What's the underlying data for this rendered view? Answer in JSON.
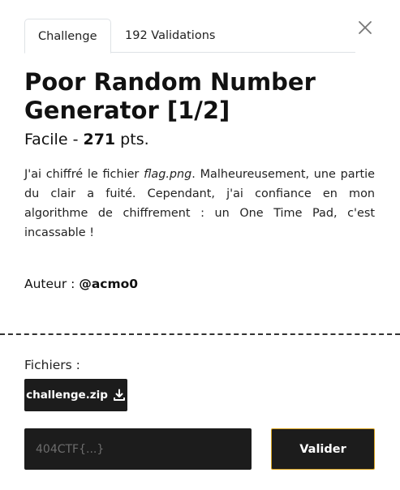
{
  "tabs": [
    {
      "label": "Challenge"
    },
    {
      "label": "192 Validations"
    }
  ],
  "close_icon": "close-icon",
  "challenge": {
    "title": "Poor Random Number Generator [1/2]",
    "difficulty": "Facile",
    "separator": " - ",
    "points": "271",
    "points_suffix": " pts.",
    "description_before": "J'ai chiffré le fichier ",
    "description_file": "flag.png",
    "description_after": ". Malheureusement, une partie du clair a fuité. Cependant, j'ai confiance en mon algorithme de chiffrement : un One Time Pad, c'est incassable !",
    "author_label": "Auteur : ",
    "author_name": "@acmo0"
  },
  "files": {
    "label": "Fichiers :",
    "items": [
      {
        "name": "challenge.zip",
        "icon": "download-icon"
      }
    ]
  },
  "submit": {
    "placeholder": "404CTF{...}",
    "button_label": "Valider",
    "accent_color": "#d9a420"
  }
}
